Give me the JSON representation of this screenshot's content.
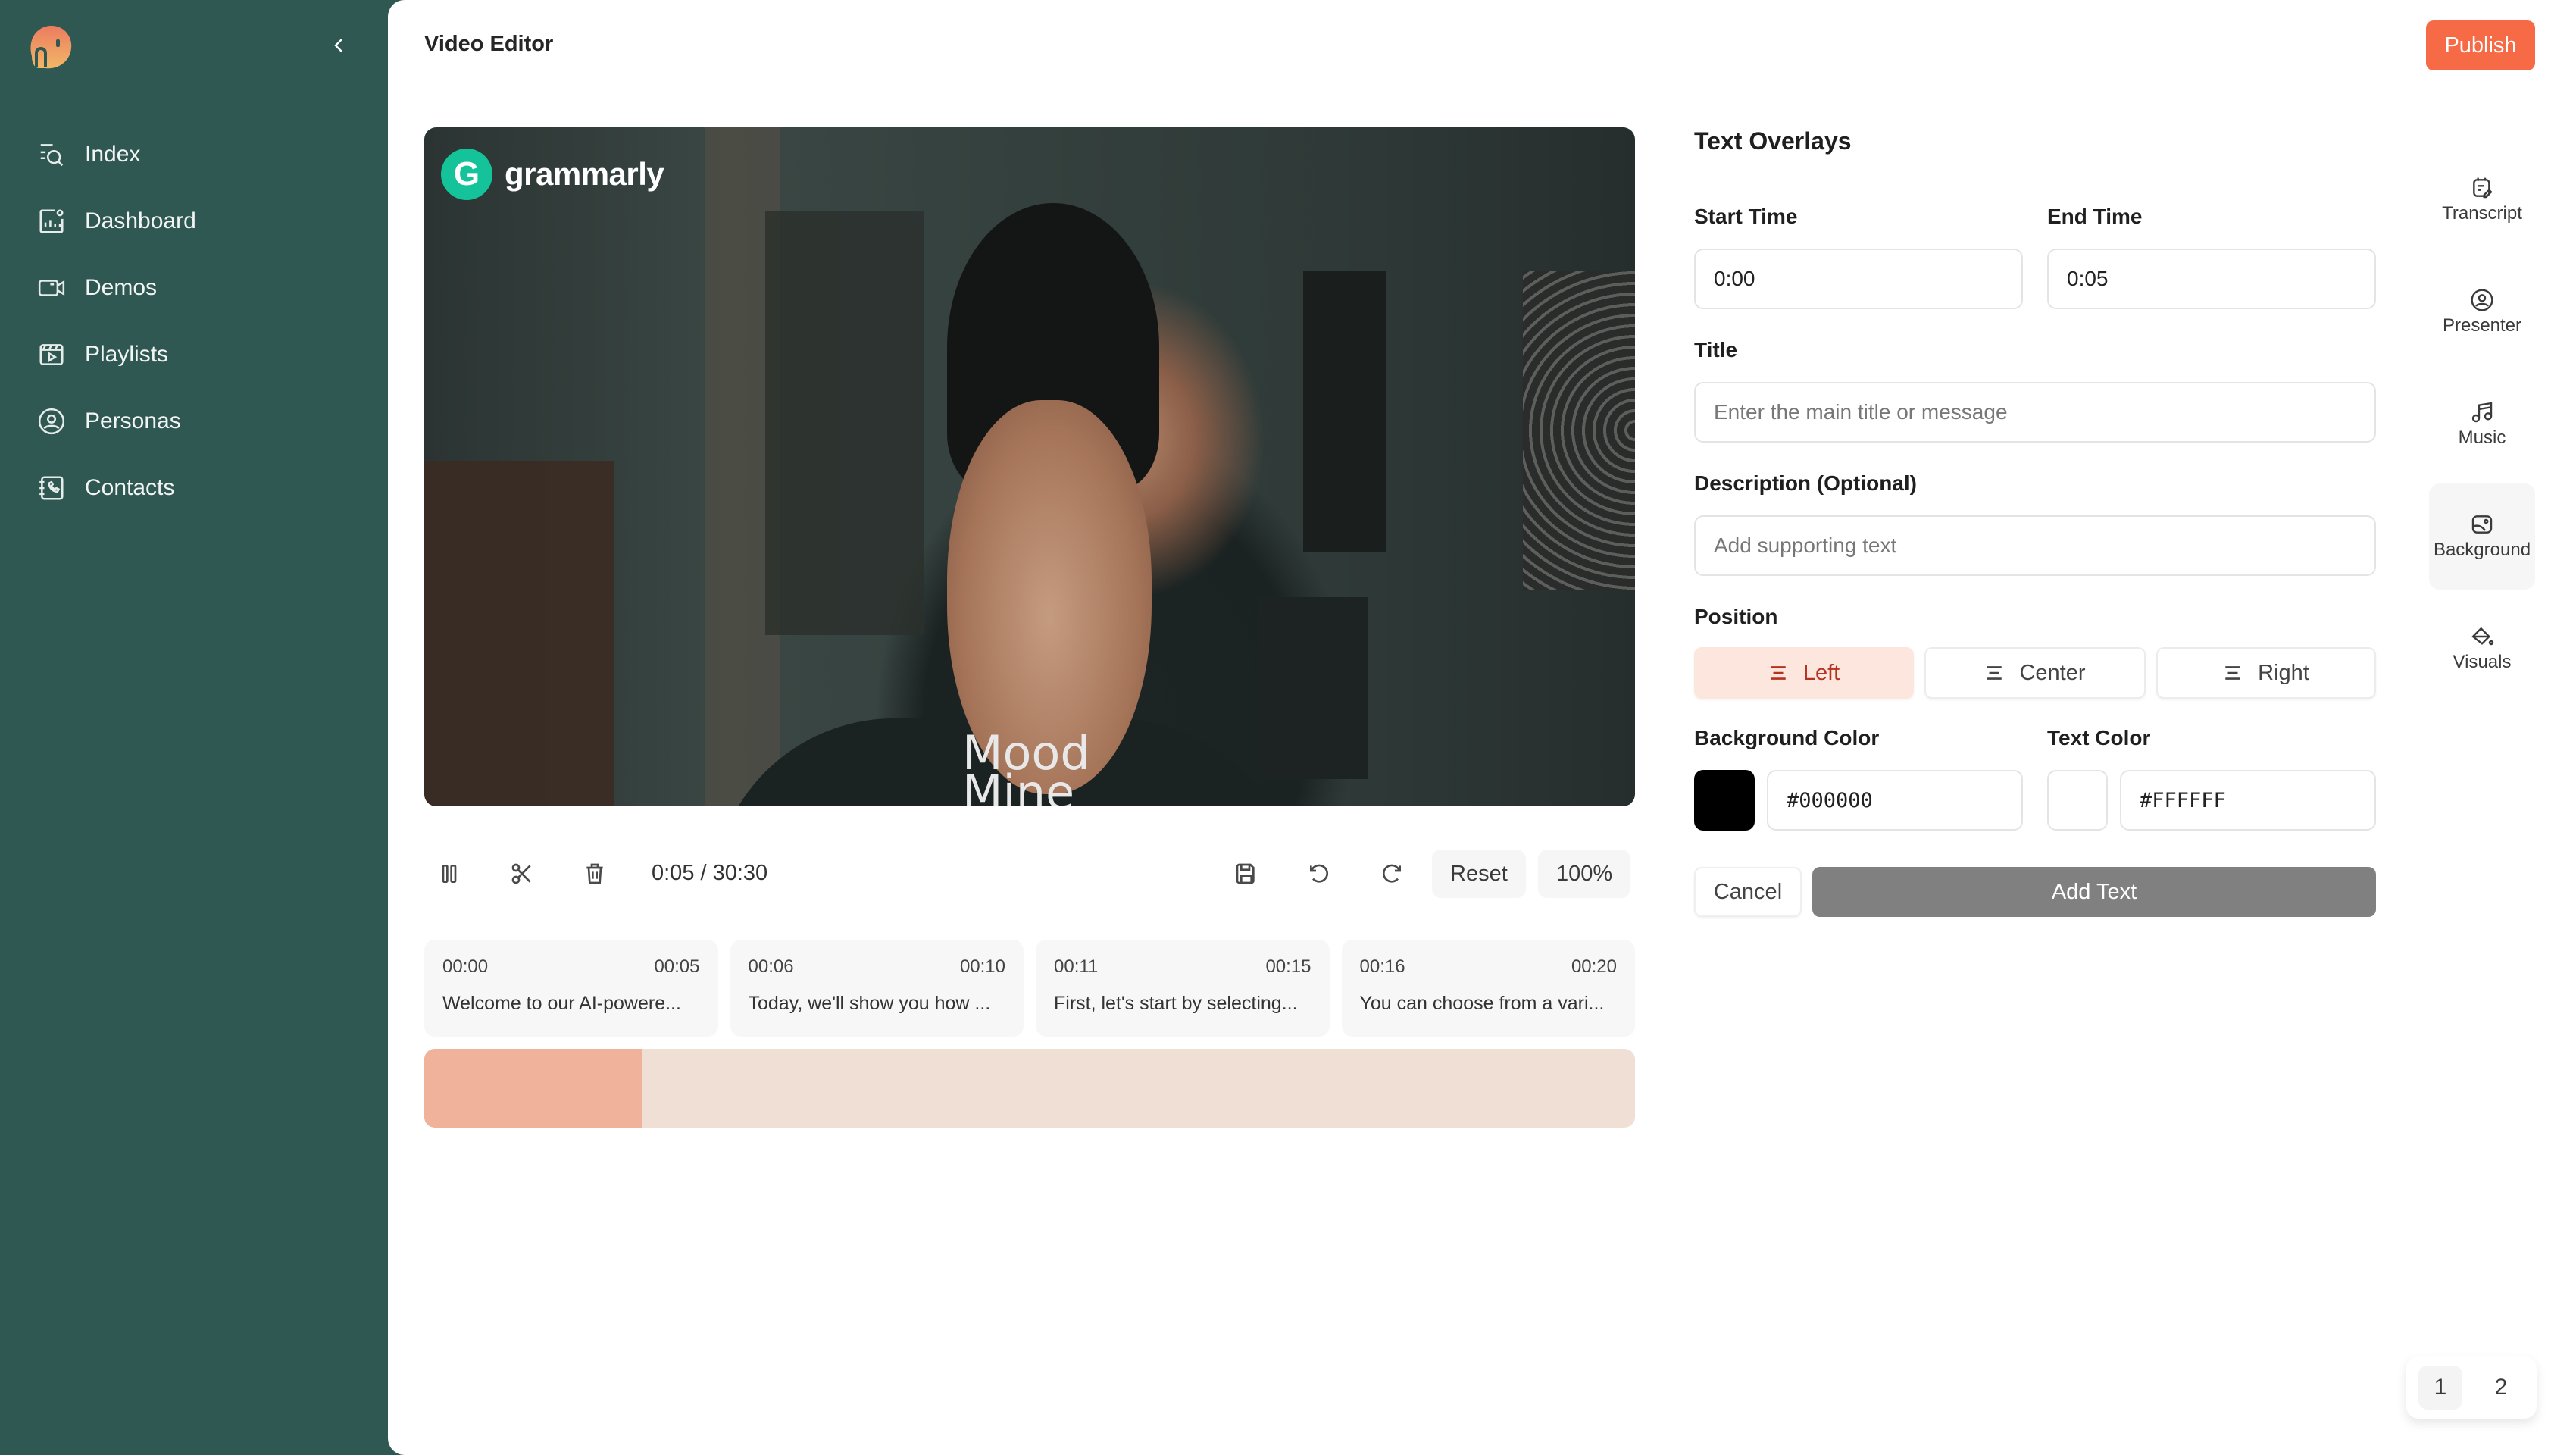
{
  "app": {
    "title": "Video Editor",
    "publish_label": "Publish",
    "colors": {
      "sidebar_bg": "#305853",
      "accent": "#f66a45",
      "position_active_bg": "#fde6de",
      "position_active_text": "#b5321f",
      "timeline_fill": "#f0b29a",
      "timeline_track": "#f0dfd5"
    }
  },
  "sidebar": {
    "collapse_icon": "chevron-left-icon",
    "items": [
      {
        "label": "Index",
        "icon": "list-search-icon"
      },
      {
        "label": "Dashboard",
        "icon": "chart-dashboard-icon"
      },
      {
        "label": "Demos",
        "icon": "video-camera-icon"
      },
      {
        "label": "Playlists",
        "icon": "playlist-play-icon"
      },
      {
        "label": "Personas",
        "icon": "user-circle-icon"
      },
      {
        "label": "Contacts",
        "icon": "contact-book-icon"
      }
    ]
  },
  "video": {
    "brand_name": "grammarly",
    "brand_initial": "G",
    "shirt_text": "Mood\nMine"
  },
  "controls": {
    "current_time": "0:05",
    "total_time": "30:30",
    "time_readout": "0:05 / 30:30",
    "reset_label": "Reset",
    "zoom_level": "100%",
    "icons": [
      "pause-icon",
      "scissors-icon",
      "trash-icon",
      "save-icon",
      "undo-icon",
      "redo-icon"
    ]
  },
  "segments": [
    {
      "start": "00:00",
      "end": "00:05",
      "text": "Welcome to our AI-powere..."
    },
    {
      "start": "00:06",
      "end": "00:10",
      "text": "Today, we'll show you how ..."
    },
    {
      "start": "00:11",
      "end": "00:15",
      "text": "First, let's start by selecting..."
    },
    {
      "start": "00:16",
      "end": "00:20",
      "text": "You can choose from a vari..."
    }
  ],
  "timeline": {
    "progress_fraction": 0.18
  },
  "text_overlays": {
    "heading": "Text Overlays",
    "start_time_label": "Start Time",
    "start_time_value": "0:00",
    "end_time_label": "End Time",
    "end_time_value": "0:05",
    "title_label": "Title",
    "title_placeholder": "Enter the main title or message",
    "description_label": "Description (Optional)",
    "description_placeholder": "Add supporting text",
    "position_label": "Position",
    "positions": [
      {
        "label": "Left",
        "active": true
      },
      {
        "label": "Center",
        "active": false
      },
      {
        "label": "Right",
        "active": false
      }
    ],
    "background_color_label": "Background Color",
    "background_color_value": "#000000",
    "text_color_label": "Text Color",
    "text_color_value": "#FFFFFF",
    "cancel_label": "Cancel",
    "add_label": "Add Text"
  },
  "tool_rail": [
    {
      "label": "Transcript",
      "icon": "transcript-icon",
      "active": false
    },
    {
      "label": "Presenter",
      "icon": "presenter-icon",
      "active": false
    },
    {
      "label": "Music",
      "icon": "music-icon",
      "active": false
    },
    {
      "label": "Background",
      "icon": "background-image-icon",
      "active": true
    },
    {
      "label": "Visuals",
      "icon": "paint-bucket-icon",
      "active": false
    }
  ],
  "pagination": {
    "pages": [
      "1",
      "2"
    ],
    "current": "1"
  }
}
